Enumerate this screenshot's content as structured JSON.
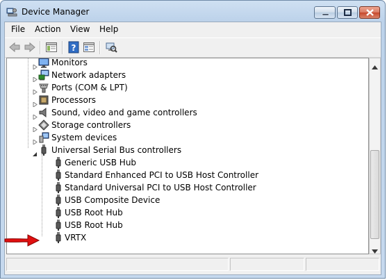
{
  "window": {
    "title": "Device Manager"
  },
  "menu": {
    "items": [
      {
        "label": "File"
      },
      {
        "label": "Action"
      },
      {
        "label": "View"
      },
      {
        "label": "Help"
      }
    ]
  },
  "toolbar": {
    "buttons": [
      "back-arrow-icon",
      "forward-arrow-icon",
      "properties-grid-icon",
      "help-question-icon",
      "update-driver-icon",
      "scan-hardware-icon"
    ]
  },
  "tree": {
    "categories": [
      {
        "label": "Monitors",
        "icon": "monitor-icon",
        "expanded": false
      },
      {
        "label": "Network adapters",
        "icon": "network-adapter-icon",
        "expanded": false
      },
      {
        "label": "Ports (COM & LPT)",
        "icon": "port-icon",
        "expanded": false
      },
      {
        "label": "Processors",
        "icon": "processor-icon",
        "expanded": false
      },
      {
        "label": "Sound, video and game controllers",
        "icon": "speaker-icon",
        "expanded": false
      },
      {
        "label": "Storage controllers",
        "icon": "storage-icon",
        "expanded": false
      },
      {
        "label": "System devices",
        "icon": "system-device-icon",
        "expanded": false
      },
      {
        "label": "Universal Serial Bus controllers",
        "icon": "usb-plug-icon",
        "expanded": true
      }
    ],
    "usb_children": [
      {
        "label": "Generic USB Hub"
      },
      {
        "label": "Standard Enhanced PCI to USB Host Controller"
      },
      {
        "label": "Standard Universal PCI to USB Host Controller"
      },
      {
        "label": "USB Composite Device"
      },
      {
        "label": "USB Root Hub"
      },
      {
        "label": "USB Root Hub"
      },
      {
        "label": "VRTX"
      }
    ]
  },
  "annotation": {
    "icon": "red-arrow-icon",
    "color": "#e01010"
  },
  "colors": {
    "title_bar": "#bcd2ea",
    "close_button": "#c7472b"
  }
}
